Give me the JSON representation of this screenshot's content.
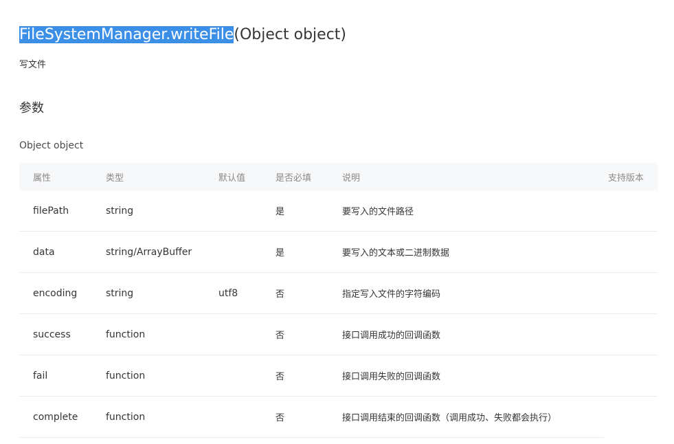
{
  "title": {
    "selected_part": "FileSystemManager.writeFile",
    "rest": "(Object object)"
  },
  "description": "写文件",
  "section_heading": "参数",
  "param_label": "Object object",
  "table": {
    "headers": {
      "attribute": "属性",
      "type": "类型",
      "default": "默认值",
      "required": "是否必填",
      "description": "说明",
      "version": "支持版本"
    },
    "rows": [
      {
        "name": "filePath",
        "type": "string",
        "default": "",
        "required": "是",
        "description": "要写入的文件路径",
        "version": ""
      },
      {
        "name": "data",
        "type": "string/ArrayBuffer",
        "default": "",
        "required": "是",
        "description": "要写入的文本或二进制数据",
        "version": ""
      },
      {
        "name": "encoding",
        "type": "string",
        "default": "utf8",
        "required": "否",
        "description": "指定写入文件的字符编码",
        "version": ""
      },
      {
        "name": "success",
        "type": "function",
        "default": "",
        "required": "否",
        "description": "接口调用成功的回调函数",
        "version": ""
      },
      {
        "name": "fail",
        "type": "function",
        "default": "",
        "required": "否",
        "description": "接口调用失败的回调函数",
        "version": ""
      },
      {
        "name": "complete",
        "type": "function",
        "default": "",
        "required": "否",
        "description": "接口调用结束的回调函数（调用成功、失败都会执行）",
        "version": ""
      }
    ]
  }
}
